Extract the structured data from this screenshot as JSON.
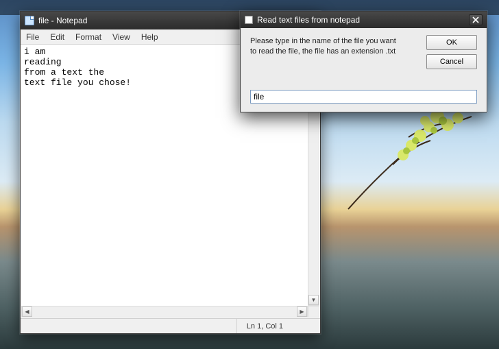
{
  "notepad": {
    "title": "file - Notepad",
    "menu": {
      "file": "File",
      "edit": "Edit",
      "format": "Format",
      "view": "View",
      "help": "Help"
    },
    "content": "i am\nreading\nfrom a text the\ntext file you chose!",
    "status": "Ln 1, Col 1"
  },
  "dialog": {
    "title": "Read text files from notepad",
    "message": "Please type in the name of the file you want to read the file, the file has an extension .txt",
    "ok": "OK",
    "cancel": "Cancel",
    "input_value": "file"
  }
}
